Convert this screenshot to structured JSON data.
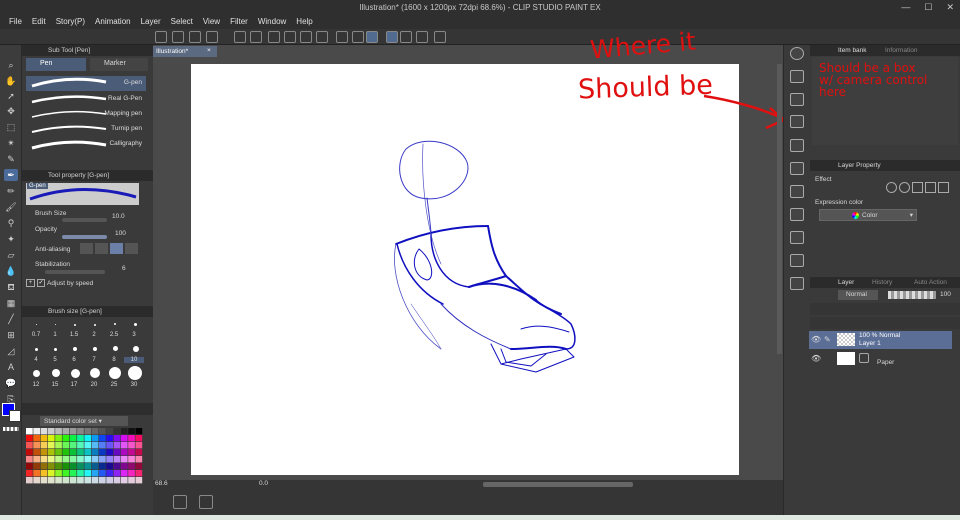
{
  "app": {
    "title": "Illustration* (1600 x 1200px 72dpi 68.6%) - CLIP STUDIO PAINT EX"
  },
  "menu": [
    "File",
    "Edit",
    "Story(P)",
    "Animation",
    "Layer",
    "Select",
    "View",
    "Filter",
    "Window",
    "Help"
  ],
  "sub_tool": {
    "header": "Sub Tool [Pen]",
    "tabs": [
      "Pen",
      "Marker"
    ],
    "brushes": [
      "G-pen",
      "Real G-Pen",
      "Mapping pen",
      "Turnip pen",
      "Calligraphy"
    ]
  },
  "tool_property": {
    "header": "Tool property [G-pen]",
    "brush_name": "G-pen",
    "brush_size_label": "Brush Size",
    "brush_size_value": "10.0",
    "opacity_label": "Opacity",
    "opacity_value": "100",
    "anti_aliasing_label": "Anti-aliasing",
    "stabilization_label": "Stabilization",
    "stabilization_value": "6",
    "adjust_by_speed_label": "Adjust by speed"
  },
  "brush_size_palette": {
    "header": "Brush size [G-pen]",
    "row1": [
      "0.7",
      "1",
      "1.5",
      "2",
      "2.5",
      "3"
    ],
    "row2": [
      "4",
      "5",
      "6",
      "7",
      "8",
      "10"
    ],
    "row3": [
      "12",
      "15",
      "17",
      "20",
      "25",
      "30"
    ]
  },
  "color_set": {
    "name": "Standard color set"
  },
  "colors": {
    "main": "#0000ff",
    "sub": "#ffffff",
    "stroke": "#1a1ab8",
    "accent": "#4b6b9a",
    "annotation": "#e01010"
  },
  "canvas": {
    "tab_label": "Illustration*",
    "zoom": "68.6",
    "angle": "0.0"
  },
  "right_panel": {
    "tabs": [
      "Item bank",
      "Information"
    ],
    "layer_property_header": "Layer Property",
    "effect_label": "Effect",
    "expression_color_label": "Expression color",
    "expression_color_value": "Color",
    "layer_tabs": [
      "Layer",
      "History",
      "Auto Action"
    ],
    "blend_mode": "Normal",
    "opacity": "100",
    "layers": [
      {
        "mode": "100 % Normal",
        "name": "Layer 1"
      },
      {
        "name": "Paper"
      }
    ]
  },
  "annotations": {
    "where_line1": "Where it",
    "where_line2": "Should be",
    "note_line1": "Should be a box",
    "note_line2": "w/ camera control",
    "note_line3": "here"
  }
}
